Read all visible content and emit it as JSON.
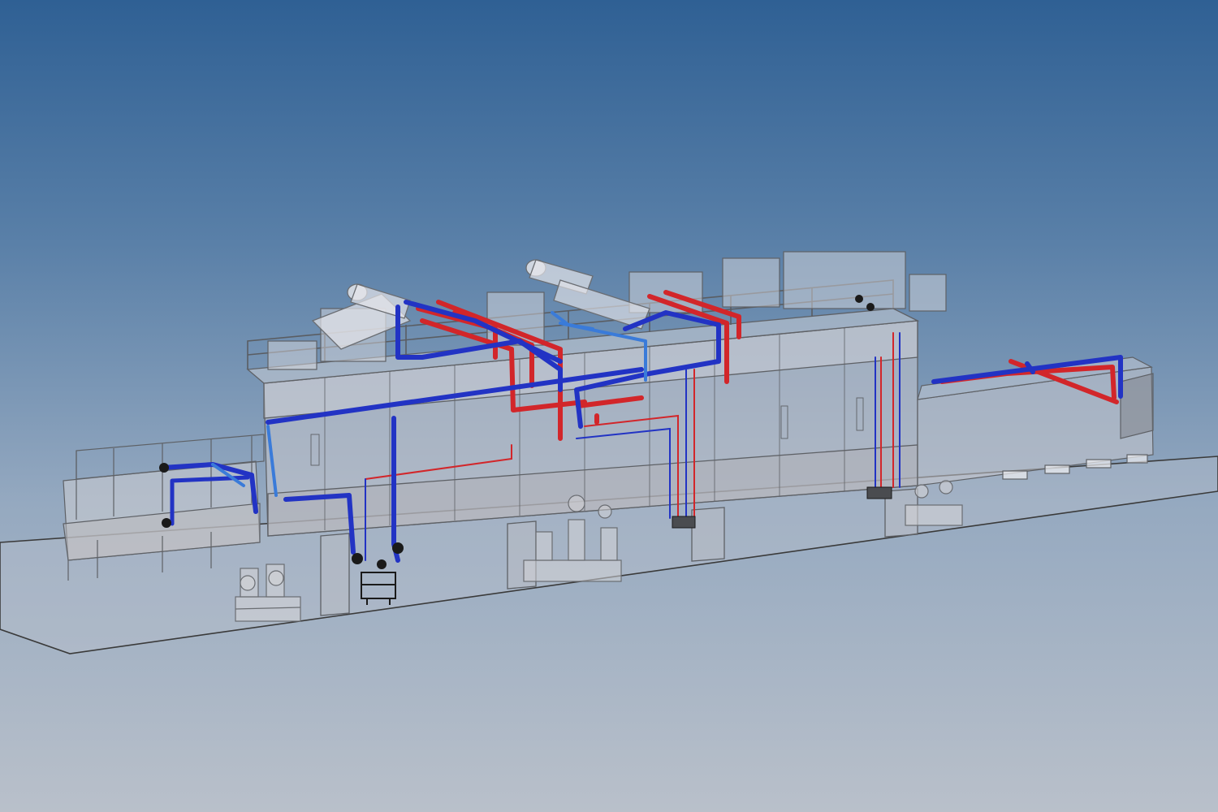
{
  "viewport": {
    "background_top": "#2f6094",
    "background_bottom": "#b9c0ca"
  },
  "model": {
    "description_icon": "3d-plant-model-icon",
    "colors": {
      "equipment_outline": "#5e6166",
      "equipment_fill": "#c9cacd",
      "supply_pipe": "#2233c4",
      "supply_pipe_light": "#3a7bd9",
      "return_pipe": "#d2262a",
      "valve": "#1a1a1a",
      "floor_line": "#3a3a3a"
    }
  }
}
